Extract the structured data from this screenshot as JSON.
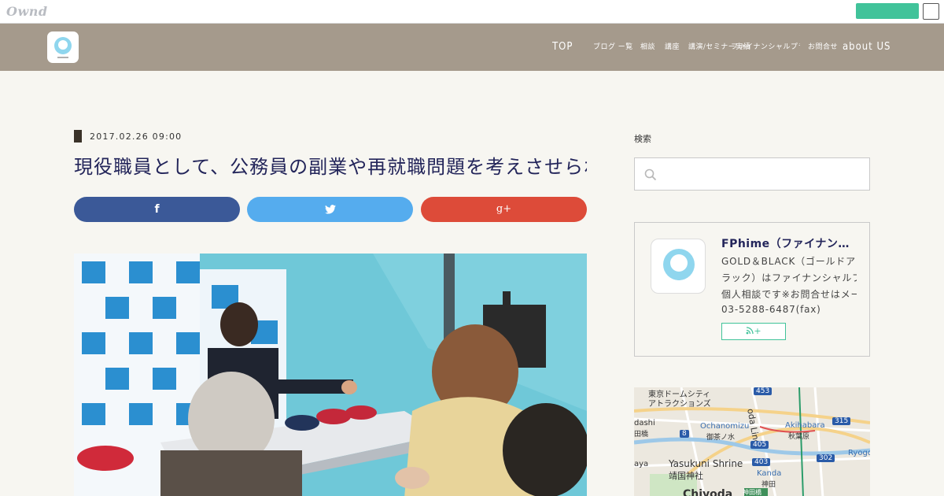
{
  "owned": {
    "logo": "Ownd"
  },
  "nav": {
    "items": [
      {
        "label": "TOP"
      },
      {
        "label": "ブログ ー覧"
      },
      {
        "label": "相談"
      },
      {
        "label": "講座"
      },
      {
        "label": "講演/セミナー実績"
      },
      {
        "label": "ファイナンシャルプランナー 事務所 概要"
      },
      {
        "label": "お問合せ"
      },
      {
        "label": "about US"
      }
    ]
  },
  "article": {
    "date": "2017.02.26 09:00",
    "title": "現役職員として、公務員の副業や再就職問題を考えさせられる一日でした",
    "share": {
      "facebook": "f",
      "twitter": "t",
      "gplus": "g+"
    }
  },
  "sidebar": {
    "search_heading": "検索",
    "profile": {
      "name": "FPhime（ファイナンシャルプランナー事務所）",
      "lines": [
        "GOLD＆BLACK（ゴールドアンドブ",
        "ラック）はファイナンシャルプランナーの",
        "個人相談です※お問合せはメールか",
        "03-5288-6487(fax)"
      ],
      "rss_label": "+"
    },
    "map": {
      "labels": [
        "東京ドームシティ",
        "アトラクションズ",
        "Ochanomizu",
        "御茶ノ水",
        "Akihabara",
        "秋葉原",
        "Yasukuni Shrine",
        "靖国神社",
        "Kanda",
        "神田",
        "Chiyoda",
        "Ryogo",
        "oda Line",
        "神田橋",
        "dashi",
        "田橋",
        "aya"
      ],
      "route_numbers": [
        "453",
        "315",
        "8",
        "403",
        "302",
        "405"
      ]
    }
  },
  "colors": {
    "header": "#a59a8c",
    "title": "#23255a",
    "accent": "#41c39a",
    "facebook": "#3b5998",
    "twitter": "#55acee",
    "gplus": "#dd4b39"
  }
}
